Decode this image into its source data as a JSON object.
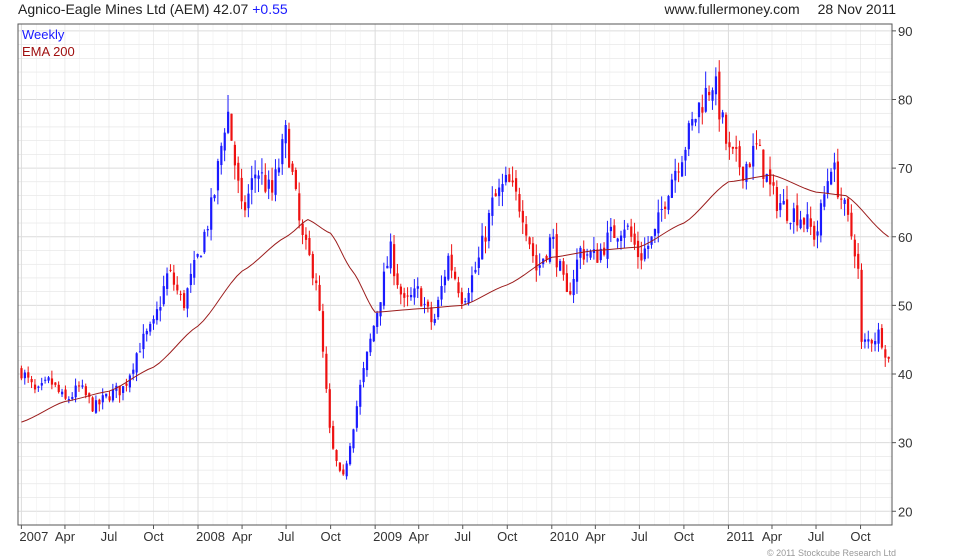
{
  "header": {
    "title": "Agnico-Eagle Mines Ltd (AEM) 42.07",
    "change": "+0.55",
    "website": "www.fullermoney.com",
    "date": "28 Nov 2011"
  },
  "legend": {
    "weekly": "Weekly",
    "ema": "EMA 200"
  },
  "credit": "© 2011 Stockcube Research Ltd",
  "colors": {
    "up": "#1a1aff",
    "down": "#ee1111",
    "ema": "#9b1c1c",
    "grid": "#dcdcdc",
    "frame": "#555555"
  },
  "chart_data": {
    "type": "candlestick",
    "title": "Agnico-Eagle Mines Ltd (AEM)",
    "interval": "Weekly",
    "x_ticks": [
      "2007",
      "Apr",
      "Jul",
      "Oct",
      "2008",
      "Apr",
      "Jul",
      "Oct",
      "2009",
      "Apr",
      "Jul",
      "Oct",
      "2010",
      "Apr",
      "Jul",
      "Oct",
      "2011",
      "Apr",
      "Jul",
      "Oct"
    ],
    "y_ticks": [
      20,
      30,
      40,
      50,
      60,
      70,
      80,
      90
    ],
    "ylim": [
      18,
      91
    ],
    "xlim": [
      "2006-12-25",
      "2011-12-05"
    ],
    "grid": true,
    "series": [
      {
        "name": "Weekly",
        "close_path": [
          [
            "2007-01-01",
            40.5
          ],
          [
            "2007-02-01",
            37
          ],
          [
            "2007-03-01",
            39
          ],
          [
            "2007-04-01",
            36
          ],
          [
            "2007-05-01",
            38
          ],
          [
            "2007-06-01",
            35
          ],
          [
            "2007-07-01",
            37
          ],
          [
            "2007-08-01",
            38
          ],
          [
            "2007-09-01",
            44
          ],
          [
            "2007-10-01",
            47
          ],
          [
            "2007-11-01",
            55
          ],
          [
            "2007-12-01",
            50
          ],
          [
            "2008-01-01",
            57
          ],
          [
            "2008-02-01",
            65
          ],
          [
            "2008-03-01",
            79
          ],
          [
            "2008-04-01",
            63
          ],
          [
            "2008-05-01",
            70
          ],
          [
            "2008-06-01",
            66
          ],
          [
            "2008-07-01",
            75
          ],
          [
            "2008-08-01",
            60
          ],
          [
            "2008-09-01",
            54
          ],
          [
            "2008-10-01",
            30
          ],
          [
            "2008-10-25",
            24
          ],
          [
            "2008-11-15",
            32
          ],
          [
            "2008-12-01",
            38
          ],
          [
            "2009-01-01",
            48
          ],
          [
            "2009-02-01",
            58
          ],
          [
            "2009-03-01",
            50
          ],
          [
            "2009-04-01",
            52
          ],
          [
            "2009-05-01",
            47
          ],
          [
            "2009-06-01",
            57
          ],
          [
            "2009-07-01",
            51
          ],
          [
            "2009-08-01",
            56
          ],
          [
            "2009-09-01",
            65
          ],
          [
            "2009-10-01",
            68
          ],
          [
            "2009-11-01",
            64
          ],
          [
            "2009-12-01",
            55
          ],
          [
            "2010-01-01",
            60
          ],
          [
            "2010-02-01",
            51
          ],
          [
            "2010-03-01",
            58
          ],
          [
            "2010-04-01",
            57
          ],
          [
            "2010-05-01",
            60
          ],
          [
            "2010-06-01",
            62
          ],
          [
            "2010-07-01",
            57
          ],
          [
            "2010-08-01",
            60
          ],
          [
            "2010-09-01",
            68
          ],
          [
            "2010-10-01",
            73
          ],
          [
            "2010-11-01",
            79
          ],
          [
            "2010-12-01",
            83
          ],
          [
            "2011-01-01",
            72
          ],
          [
            "2011-02-01",
            70
          ],
          [
            "2011-03-01",
            73
          ],
          [
            "2011-04-01",
            66
          ],
          [
            "2011-05-01",
            64
          ],
          [
            "2011-06-01",
            63
          ],
          [
            "2011-07-01",
            60
          ],
          [
            "2011-08-01",
            71
          ],
          [
            "2011-09-01",
            63
          ],
          [
            "2011-09-25",
            57
          ],
          [
            "2011-10-01",
            44
          ],
          [
            "2011-10-20",
            45
          ],
          [
            "2011-11-10",
            46
          ],
          [
            "2011-11-28",
            42
          ]
        ]
      },
      {
        "name": "EMA 200",
        "points": [
          [
            "2007-01-01",
            33
          ],
          [
            "2007-04-01",
            36
          ],
          [
            "2007-07-01",
            37.5
          ],
          [
            "2007-10-01",
            41
          ],
          [
            "2008-01-01",
            47
          ],
          [
            "2008-04-01",
            55
          ],
          [
            "2008-07-01",
            60
          ],
          [
            "2008-08-15",
            62.5
          ],
          [
            "2008-10-01",
            60.5
          ],
          [
            "2008-11-15",
            55
          ],
          [
            "2009-01-01",
            49
          ],
          [
            "2009-04-01",
            49.5
          ],
          [
            "2009-07-01",
            50
          ],
          [
            "2009-10-01",
            53
          ],
          [
            "2010-01-01",
            57
          ],
          [
            "2010-04-01",
            58
          ],
          [
            "2010-07-01",
            58.5
          ],
          [
            "2010-10-01",
            62
          ],
          [
            "2011-01-01",
            68
          ],
          [
            "2011-04-01",
            69
          ],
          [
            "2011-07-01",
            66.5
          ],
          [
            "2011-09-01",
            66
          ],
          [
            "2011-11-28",
            60
          ]
        ]
      }
    ]
  }
}
